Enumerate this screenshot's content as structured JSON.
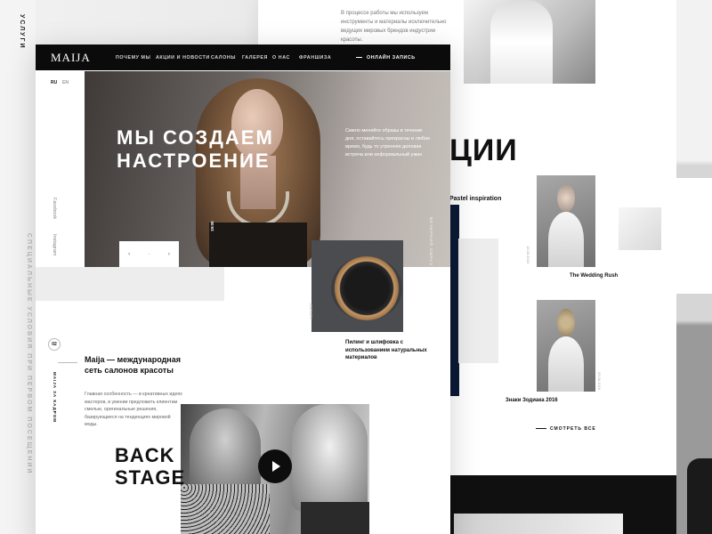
{
  "left_strip": {
    "services": "УСЛУГИ",
    "offer": "СПЕЦИАЛЬНЫЕ УСЛОВИЯ ПРИ ПЕРВОМ ПОСЕЩЕНИИ"
  },
  "back_page": {
    "intro_text": "В процессе работы мы используем инструменты и материалы исключительно ведущих мировых брендов индустрии красоты.",
    "big_word": "ЦИИ",
    "pastel_label": "Pastel inspiration",
    "card1_title": "The Wedding Rush",
    "card1_date": "15.08.2016",
    "card2_title": "Знаки Зодиака 2016",
    "card2_date": "05.08.2016",
    "see_all": "СМОТРЕТЬ ВСЕ"
  },
  "nav": {
    "logo": "MAIJA",
    "items": [
      "ПОЧЕМУ МЫ",
      "АКЦИИ И НОВОСТИ",
      "САЛОНЫ",
      "ГАЛЕРЕЯ",
      "О НАС",
      "ФРАНШИЗА"
    ],
    "online": "ОНЛАЙН ЗАПИСЬ"
  },
  "lang": {
    "ru": "RU",
    "en": "EN"
  },
  "hero": {
    "title": "МЫ СОЗДАЕМ НАСТРОЕНИЕ",
    "description": "Смело меняйте образы в течение дня, оставайтесь прекрасны в любое время, будь то утренняя деловая встреча или неформальный ужин",
    "vertical_label": "ВЕЧЕРНИЙ ОБРАЗ",
    "time": "19:00",
    "prev": "‹",
    "dot": "·",
    "next": "›"
  },
  "social": {
    "facebook": "Facebook",
    "instagram": "Instagram"
  },
  "about": {
    "number": "02",
    "vertical": "MAIJA ЗА КАДРОМ",
    "title": "Maija — международная сеть салонов красоты",
    "text": "Главная особенность — в креативных идеях мастеров, в умении предложить клиентам смелые, оригинальные решения, базирующиеся на тенденциях мировой моды."
  },
  "product": {
    "caption": "Пилинг и шлифовка с использованием натуральных материалов",
    "vertical": "КАТАЛОГ"
  },
  "backstage": {
    "line1": "BACK",
    "line2": "STAGE"
  }
}
